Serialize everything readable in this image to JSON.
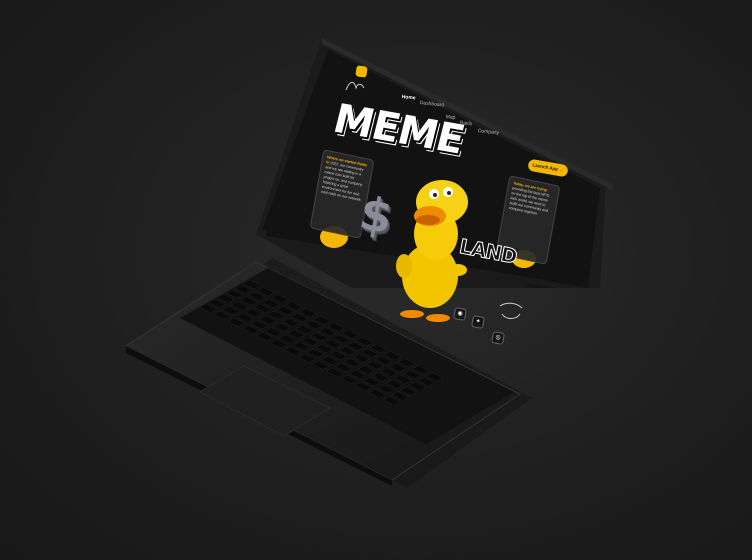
{
  "screen": {
    "nav": [
      "Home",
      "Dashboard",
      "Map",
      "Raids",
      "Company"
    ],
    "launch_label": "Launch App →",
    "hero_word_top": "MEME",
    "hero_word_bottom": "LAND",
    "left_card": {
      "highlight": "Where we started Raids in",
      "body": "2022, our community and we are raiding in a meme coin built for project on, and company fostering a great environment for fun and cool raids on our network."
    },
    "right_card": {
      "highlight": "Today, we are trying",
      "body": "providing the best NFTs on the top of the meme tech world, we want to build our community and company together."
    },
    "social_icons": [
      "discord-icon",
      "twitter-icon",
      "instagram-icon"
    ],
    "dollar_glyph": "$"
  },
  "colors": {
    "accent": "#f5b800",
    "screen_bg": "#121212",
    "device_body": "#1b1b1b"
  }
}
